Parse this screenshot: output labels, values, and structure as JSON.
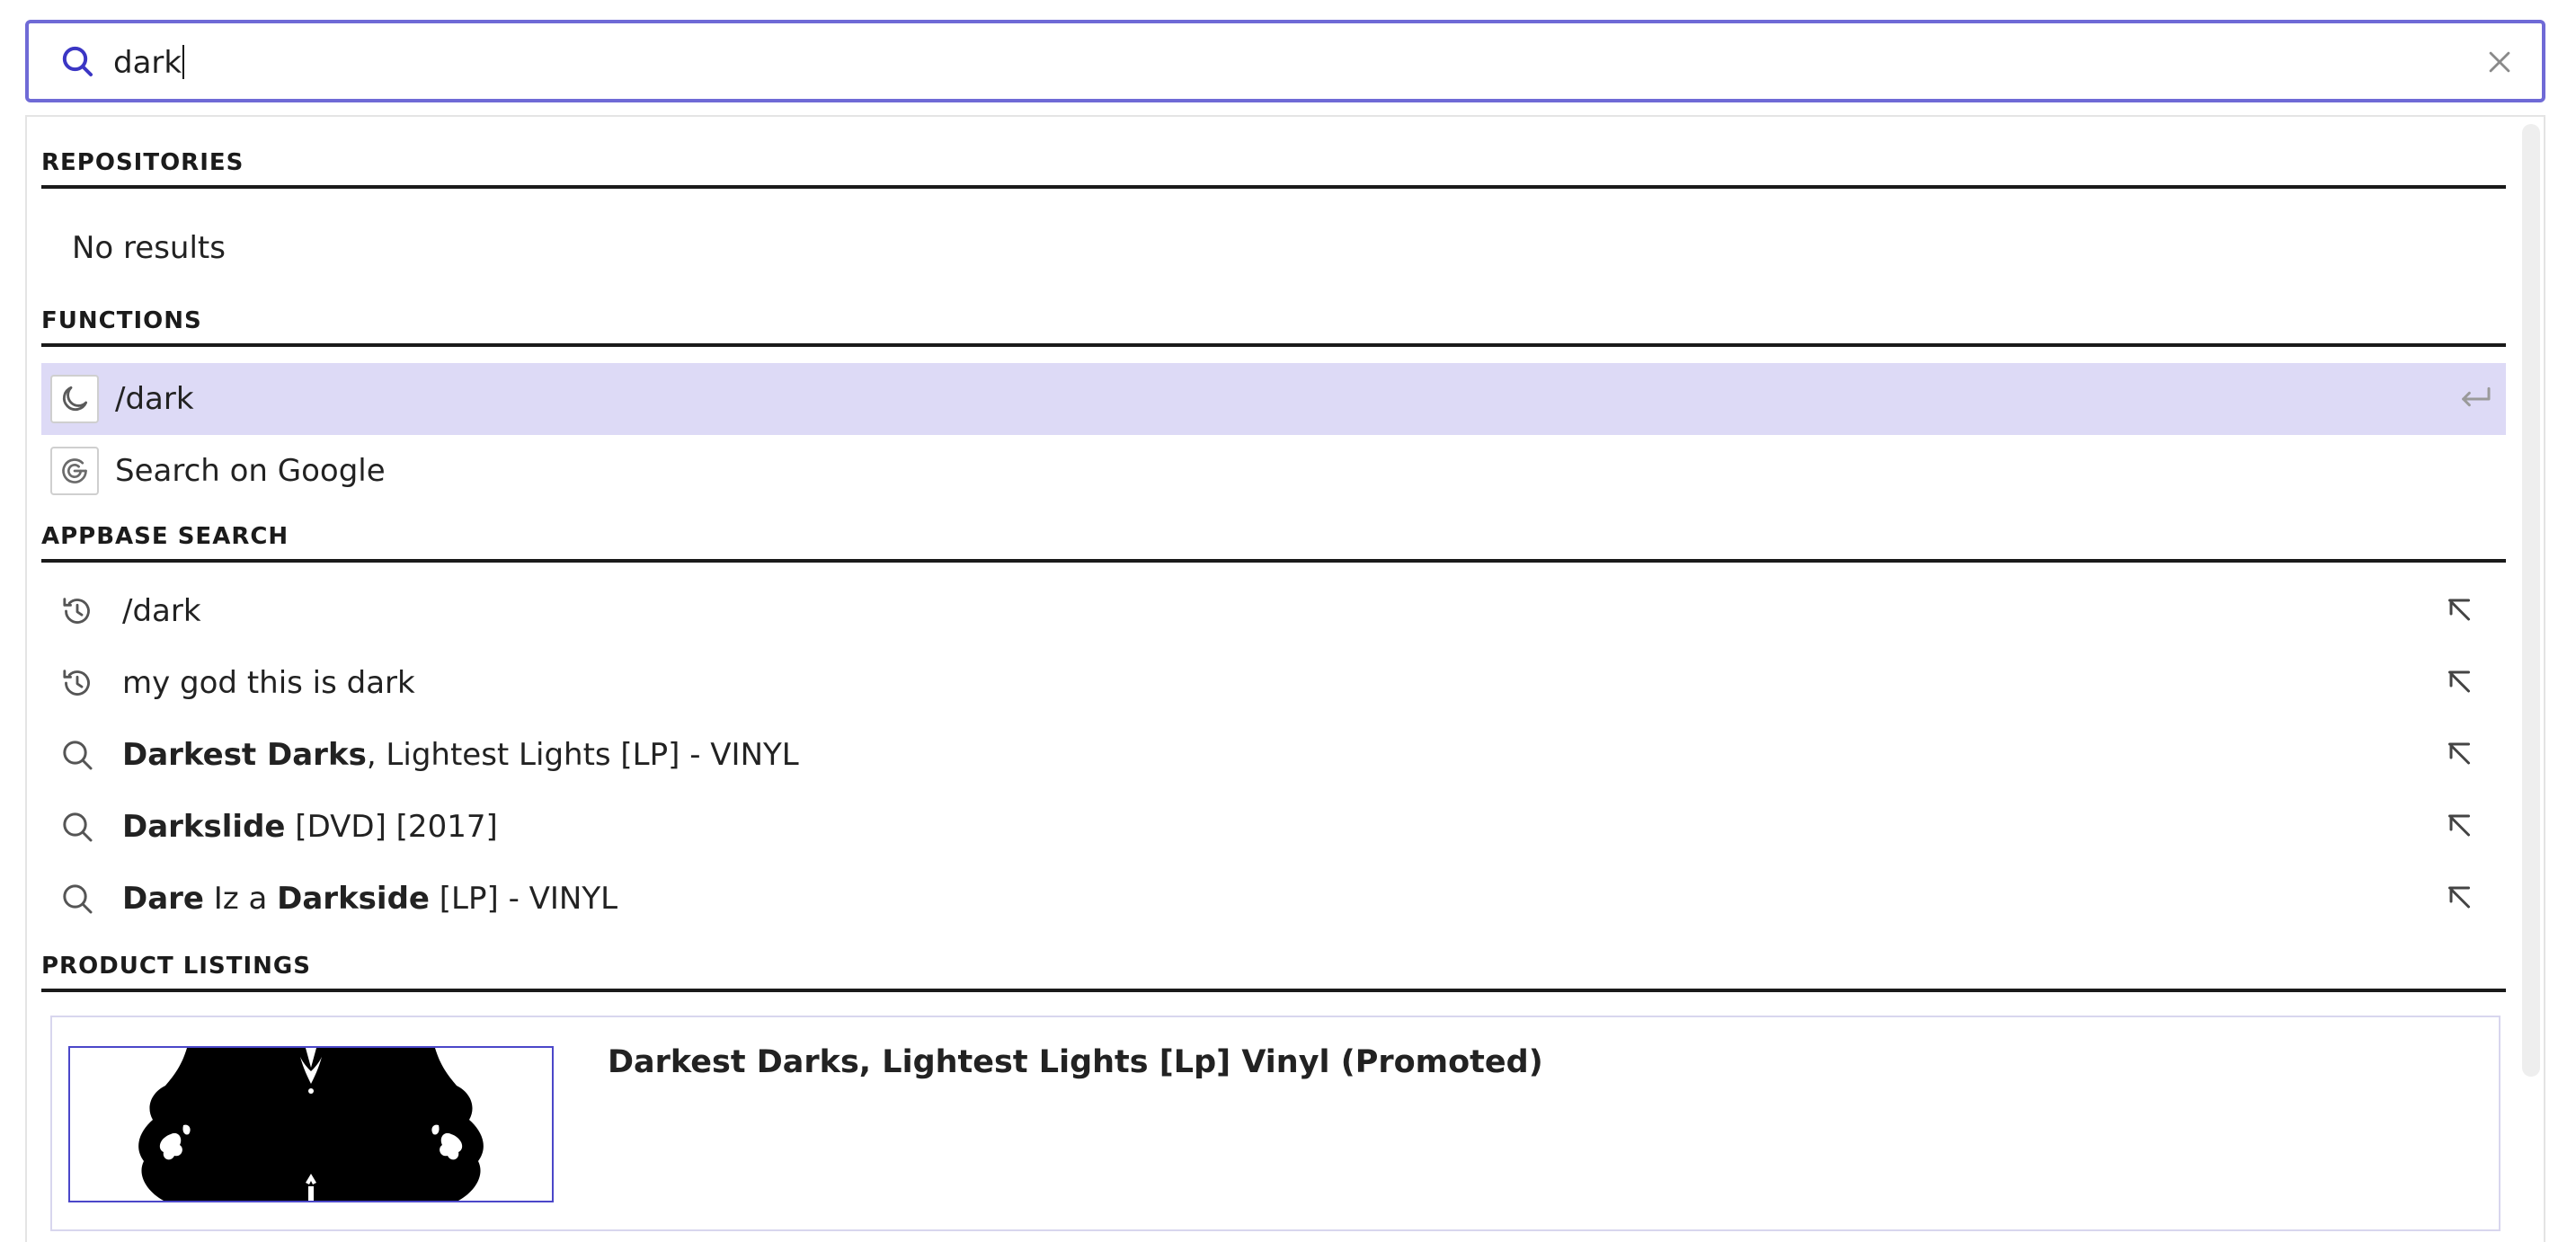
{
  "search": {
    "value": "dark",
    "icon": "search-icon",
    "clear_icon": "close-icon"
  },
  "sections": {
    "repositories": {
      "header": "REPOSITORIES",
      "empty_text": "No results"
    },
    "functions": {
      "header": "FUNCTIONS",
      "items": [
        {
          "label": "/dark",
          "icon": "moon-icon",
          "active": true
        },
        {
          "label": "Search on Google",
          "icon": "google-icon",
          "active": false
        }
      ]
    },
    "appbase_search": {
      "header": "APPBASE SEARCH",
      "items": [
        {
          "type": "history",
          "icon": "history-icon",
          "parts": [
            {
              "text": "/dark",
              "bold": false
            }
          ]
        },
        {
          "type": "history",
          "icon": "history-icon",
          "parts": [
            {
              "text": "my god this is dark",
              "bold": false
            }
          ]
        },
        {
          "type": "suggestion",
          "icon": "search-icon",
          "parts": [
            {
              "text": "Darkest Darks",
              "bold": true
            },
            {
              "text": ", Lightest Lights [LP] - VINYL",
              "bold": false
            }
          ]
        },
        {
          "type": "suggestion",
          "icon": "search-icon",
          "parts": [
            {
              "text": "Darkslide",
              "bold": true
            },
            {
              "text": " [DVD] [2017]",
              "bold": false
            }
          ]
        },
        {
          "type": "suggestion",
          "icon": "search-icon",
          "parts": [
            {
              "text": "Dare",
              "bold": true
            },
            {
              "text": " Iz a ",
              "bold": false
            },
            {
              "text": "Darkside",
              "bold": true
            },
            {
              "text": " [LP] - VINYL",
              "bold": false
            }
          ]
        }
      ]
    },
    "product_listings": {
      "header": "PRODUCT LISTINGS",
      "items": [
        {
          "title": "Darkest Darks, Lightest Lights [Lp] Vinyl (Promoted)",
          "image": "album-cover-image"
        }
      ]
    }
  },
  "colors": {
    "accent": "#6f6ad6",
    "active_row": "#dddaf6",
    "header_rule": "#1a1a1a",
    "product_border": "#4b47c9"
  }
}
